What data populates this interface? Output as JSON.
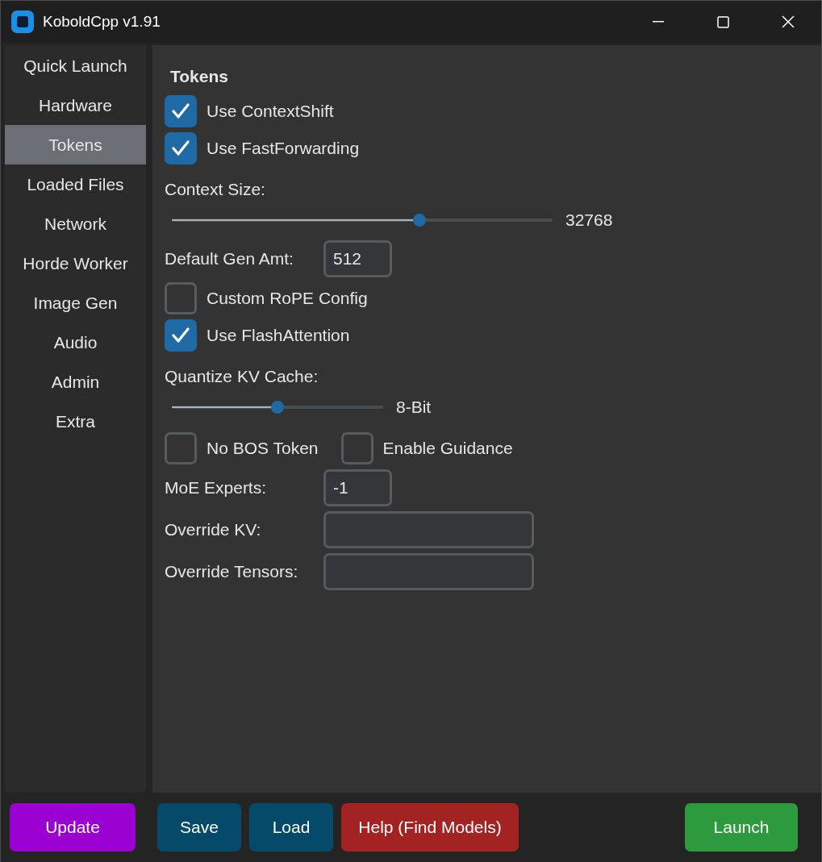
{
  "window": {
    "title": "KoboldCpp v1.91"
  },
  "sidebar": {
    "items": [
      {
        "label": "Quick Launch",
        "selected": false
      },
      {
        "label": "Hardware",
        "selected": false
      },
      {
        "label": "Tokens",
        "selected": true
      },
      {
        "label": "Loaded Files",
        "selected": false
      },
      {
        "label": "Network",
        "selected": false
      },
      {
        "label": "Horde Worker",
        "selected": false
      },
      {
        "label": "Image Gen",
        "selected": false
      },
      {
        "label": "Audio",
        "selected": false
      },
      {
        "label": "Admin",
        "selected": false
      },
      {
        "label": "Extra",
        "selected": false
      }
    ]
  },
  "panel": {
    "title": "Tokens",
    "rows": [
      {
        "kind": "checkbox",
        "label": "Use ContextShift",
        "checked": true
      },
      {
        "kind": "checkbox",
        "label": "Use FastForwarding",
        "checked": true
      },
      {
        "kind": "label",
        "text": "Context Size:"
      },
      {
        "kind": "slider",
        "level": 0.65,
        "reading": "32768"
      },
      {
        "kind": "field",
        "label": "Default Gen Amt:",
        "value": "512"
      },
      {
        "kind": "checkbox",
        "label": "Custom RoPE Config",
        "checked": false
      },
      {
        "kind": "checkbox",
        "label": "Use FlashAttention",
        "checked": true
      },
      {
        "kind": "label",
        "text": "Quantize KV Cache:"
      },
      {
        "kind": "short-slider",
        "level": 0.5,
        "reading": "8-Bit"
      },
      {
        "kind": "checkbox-pair",
        "items": [
          {
            "label": "No BOS Token",
            "checked": false
          },
          {
            "label": "Enable Guidance",
            "checked": false
          }
        ]
      },
      {
        "kind": "field",
        "label": "MoE Experts:",
        "value": "-1"
      },
      {
        "kind": "wide-field",
        "label": "Override KV:"
      },
      {
        "kind": "wide-field",
        "label": "Override Tensors:"
      }
    ]
  },
  "buttons": [
    {
      "label": "Update",
      "kind": "update"
    },
    {
      "label": "Save",
      "kind": "save"
    },
    {
      "label": "Load",
      "kind": "load"
    },
    {
      "label": "Help (Find Models)",
      "kind": "help"
    },
    {
      "label": "Launch",
      "kind": "launch"
    }
  ]
}
